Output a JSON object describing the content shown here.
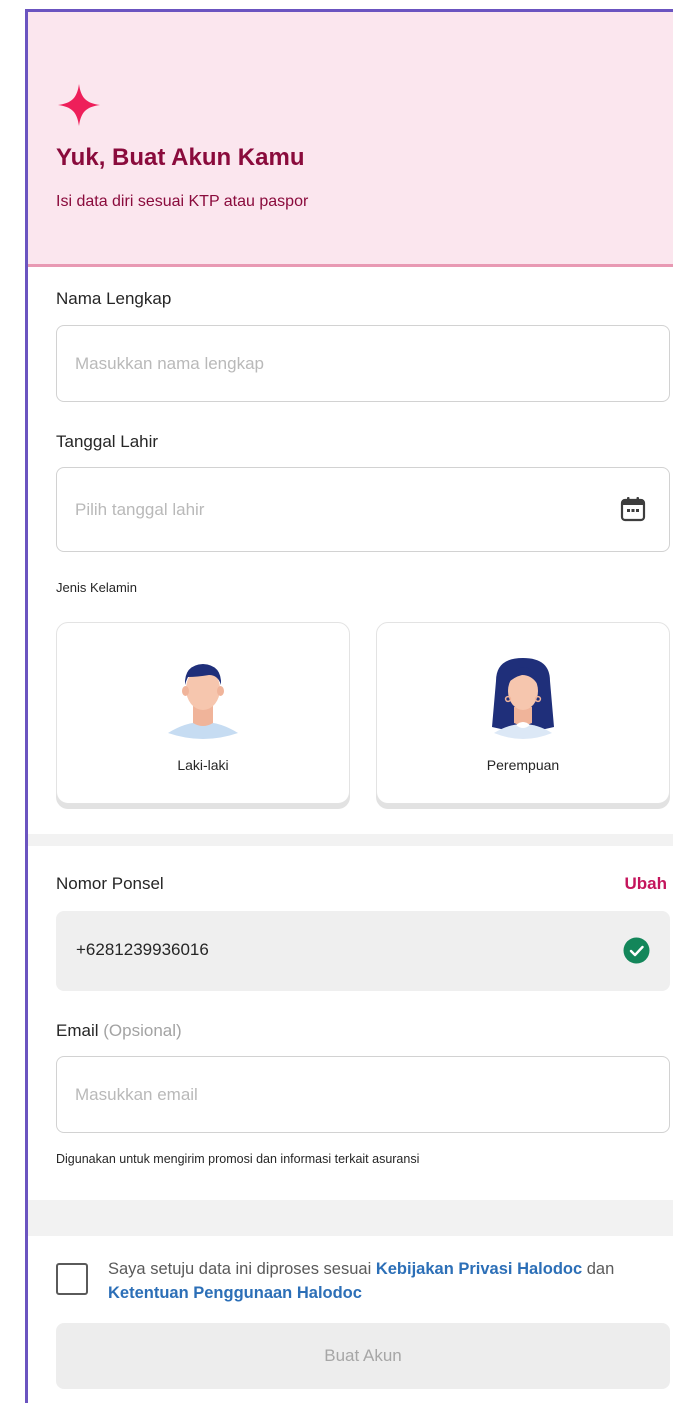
{
  "header": {
    "icon": "sparkle-icon",
    "title": "Yuk, Buat Akun Kamu",
    "subtitle": "Isi data diri sesuai KTP atau paspor"
  },
  "form": {
    "name": {
      "label": "Nama Lengkap",
      "placeholder": "Masukkan nama lengkap",
      "value": ""
    },
    "birthdate": {
      "label": "Tanggal Lahir",
      "placeholder": "Pilih tanggal lahir",
      "value": "",
      "icon": "calendar-icon"
    },
    "gender": {
      "label": "Jenis Kelamin",
      "options": [
        {
          "label": "Laki-laki",
          "icon": "male-avatar-icon"
        },
        {
          "label": "Perempuan",
          "icon": "female-avatar-icon"
        }
      ]
    },
    "phone": {
      "label": "Nomor Ponsel",
      "change_label": "Ubah",
      "value": "+6281239936016",
      "icon": "verified-check-icon"
    },
    "email": {
      "label": "Email",
      "optional_label": "(Opsional)",
      "placeholder": "Masukkan email",
      "value": "",
      "helper": "Digunakan untuk mengirim promosi dan informasi terkait asuransi"
    }
  },
  "consent": {
    "text_before": "Saya setuju data ini diproses sesuai ",
    "privacy_link": "Kebijakan Privasi Halodoc",
    "text_middle": " dan ",
    "terms_link": "Ketentuan Penggunaan Halodoc",
    "checked": false
  },
  "submit_label": "Buat Akun",
  "colors": {
    "brand": "#8a0b3c",
    "accent": "#c4155c",
    "hero_bg": "#fbe6ee",
    "link": "#2c6fb7",
    "success": "#13865a"
  }
}
